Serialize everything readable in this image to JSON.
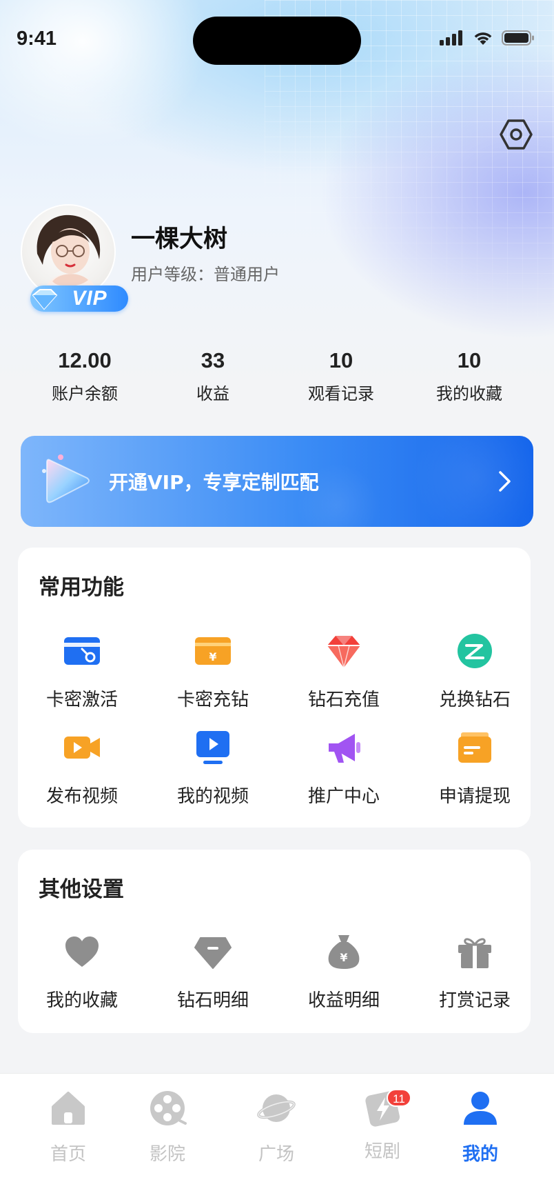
{
  "status_bar": {
    "time": "9:41"
  },
  "profile": {
    "name": "一棵大树",
    "level_text": "用户等级：普通用户",
    "vip_badge": "VIP"
  },
  "stats": [
    {
      "value": "12.00",
      "label": "账户余额"
    },
    {
      "value": "33",
      "label": "收益"
    },
    {
      "value": "10",
      "label": "观看记录"
    },
    {
      "value": "10",
      "label": "我的收藏"
    }
  ],
  "vip_banner": {
    "text": "开通VIP，专享定制匹配"
  },
  "common": {
    "title": "常用功能",
    "items": [
      {
        "label": "卡密激活",
        "icon": "card-key-icon",
        "color": "#1f6ff2"
      },
      {
        "label": "卡密充钻",
        "icon": "card-recharge-icon",
        "color": "#f7a225"
      },
      {
        "label": "钻石充值",
        "icon": "diamond-icon",
        "color": "#f2403a"
      },
      {
        "label": "兑换钻石",
        "icon": "exchange-icon",
        "color": "#23c4a0"
      },
      {
        "label": "发布视频",
        "icon": "video-camera-icon",
        "color": "#f7a225"
      },
      {
        "label": "我的视频",
        "icon": "tv-play-icon",
        "color": "#1f6ff2"
      },
      {
        "label": "推广中心",
        "icon": "megaphone-icon",
        "color": "#a154f2"
      },
      {
        "label": "申请提现",
        "icon": "wallet-icon",
        "color": "#f7a225"
      }
    ]
  },
  "other": {
    "title": "其他设置",
    "items": [
      {
        "label": "我的收藏",
        "icon": "heart-icon"
      },
      {
        "label": "钻石明细",
        "icon": "diamond-detail-icon"
      },
      {
        "label": "收益明细",
        "icon": "money-bag-icon"
      },
      {
        "label": "打赏记录",
        "icon": "gift-icon"
      }
    ]
  },
  "tabbar": {
    "tabs": [
      {
        "label": "首页",
        "icon": "home-icon"
      },
      {
        "label": "影院",
        "icon": "film-reel-icon"
      },
      {
        "label": "广场",
        "icon": "planet-icon"
      },
      {
        "label": "短剧",
        "icon": "short-drama-icon",
        "badge": "11"
      },
      {
        "label": "我的",
        "icon": "user-icon",
        "active": true
      }
    ]
  },
  "colors": {
    "accent": "#1f6ff2",
    "inactive_tab": "#c3c3c3",
    "badge": "#f2403a"
  }
}
